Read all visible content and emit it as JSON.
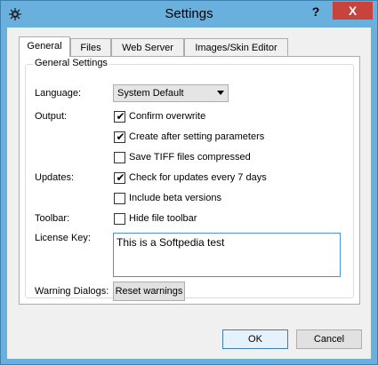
{
  "window": {
    "title": "Settings",
    "help_glyph": "?",
    "close_glyph": "X"
  },
  "tabs": [
    {
      "label": "General",
      "active": true
    },
    {
      "label": "Files",
      "active": false
    },
    {
      "label": "Web Server",
      "active": false
    },
    {
      "label": "Images/Skin Editor",
      "active": false
    }
  ],
  "general": {
    "group_title": "General Settings",
    "language_label": "Language:",
    "language_value": "System Default",
    "output_label": "Output:",
    "output_options": [
      {
        "label": "Confirm overwrite",
        "checked": true
      },
      {
        "label": "Create after setting parameters",
        "checked": true
      },
      {
        "label": "Save TIFF files compressed",
        "checked": false
      }
    ],
    "updates_label": "Updates:",
    "update_options": [
      {
        "label": "Check for updates every 7 days",
        "checked": true
      },
      {
        "label": "Include beta versions",
        "checked": false
      }
    ],
    "toolbar_label": "Toolbar:",
    "toolbar_option": {
      "label": "Hide file toolbar",
      "checked": false
    },
    "license_label": "License Key:",
    "license_value": "This is a Softpedia test",
    "warning_label": "Warning Dialogs:",
    "reset_button": "Reset warnings"
  },
  "footer": {
    "ok_label": "OK",
    "cancel_label": "Cancel"
  },
  "check_glyph": "✔",
  "colors": {
    "titlebar": "#6ab0dc",
    "close": "#c7433b",
    "panel": "#f0f0f0"
  }
}
